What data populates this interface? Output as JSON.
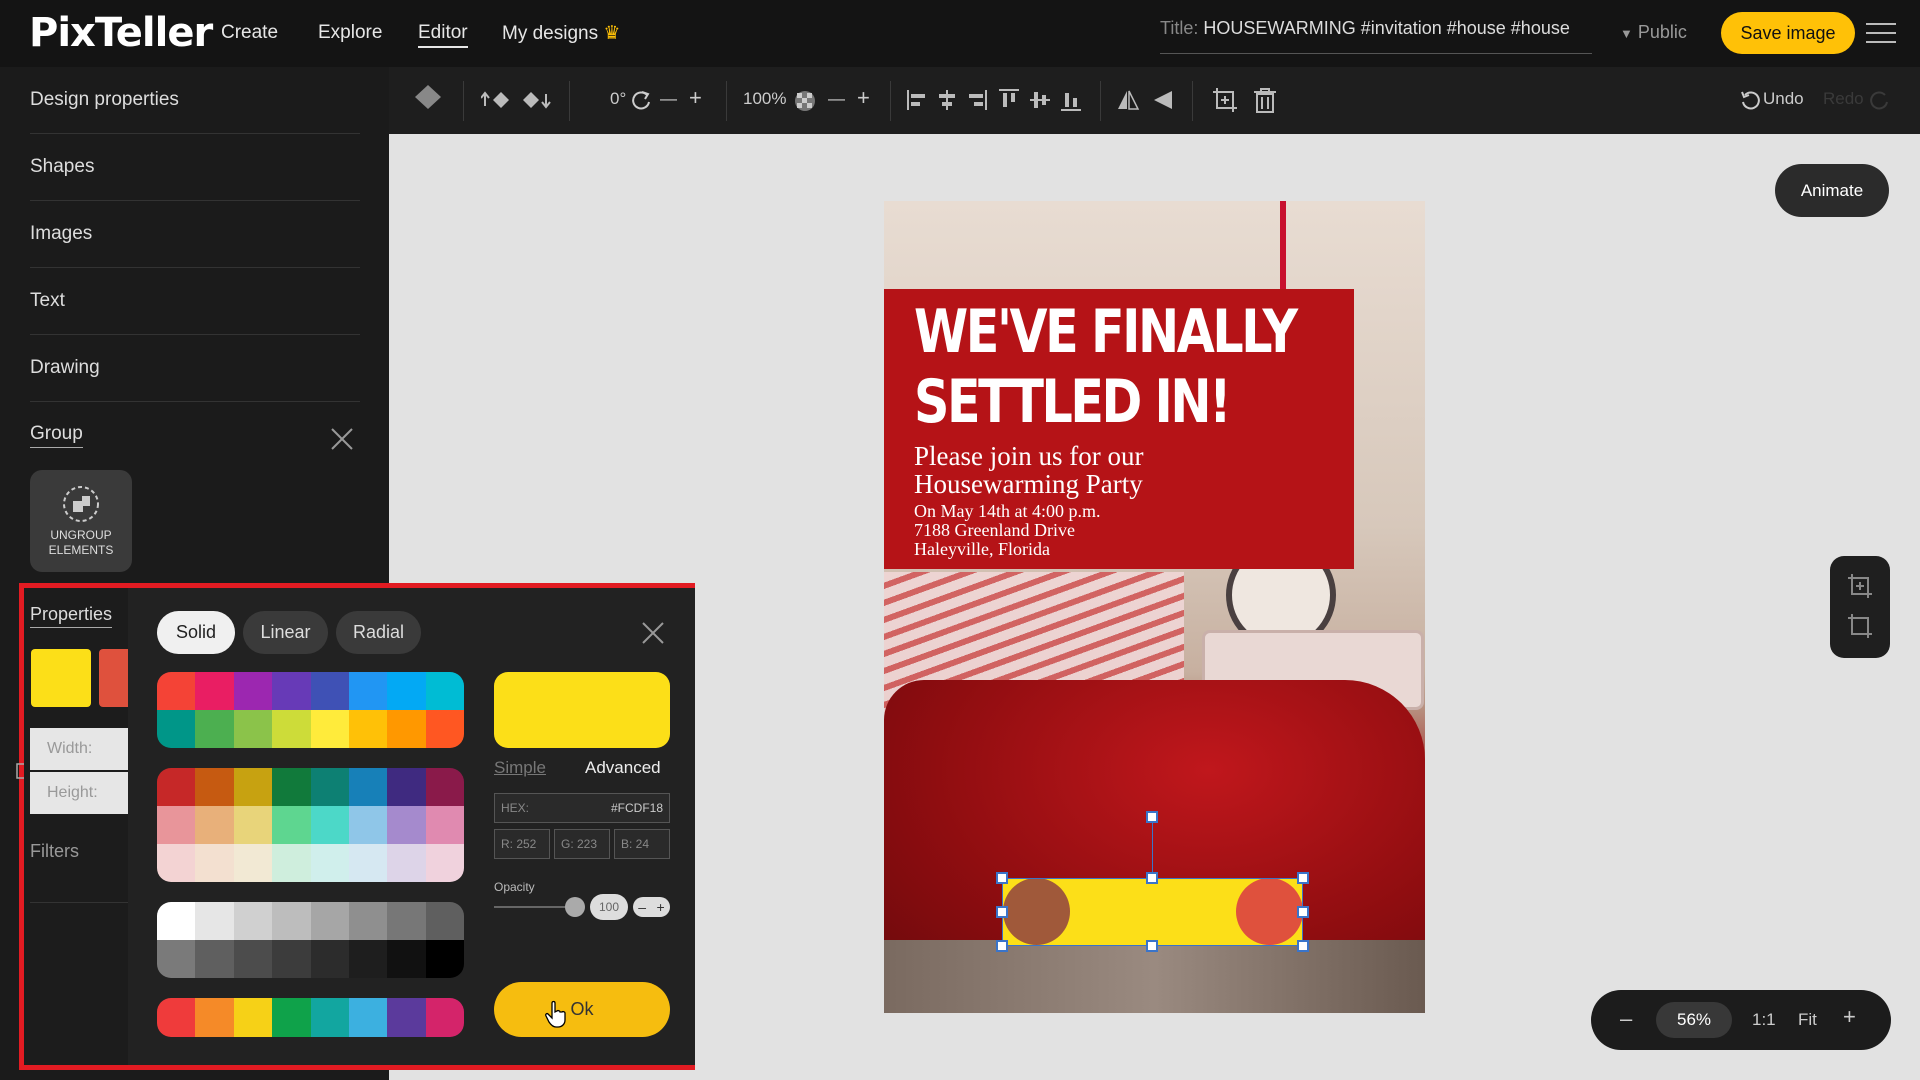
{
  "app": {
    "logo": "PixTeller",
    "nav": [
      "Create",
      "Explore",
      "Editor",
      "My designs"
    ],
    "title_label": "Title:",
    "title_value": "HOUSEWARMING #invitation #house #house",
    "visibility": "Public",
    "save_label": "Save image"
  },
  "sidebar": {
    "items": [
      "Design properties",
      "Shapes",
      "Images",
      "Text",
      "Drawing",
      "Group"
    ],
    "ungroup_line1": "UNGROUP",
    "ungroup_line2": "ELEMENTS"
  },
  "toolbar": {
    "rotation": "0°",
    "zoom_pct": "100%",
    "undo": "Undo",
    "redo": "Redo"
  },
  "design": {
    "headline_1": "WE'VE FINALLY",
    "headline_2": "SETTLED IN!",
    "subhead_1": "Please join us for our",
    "subhead_2": "Housewarming Party",
    "detail_1": "On May 14th at 4:00 p.m.",
    "detail_2": "7188 Greenland Drive",
    "detail_3": "Haleyville, Florida"
  },
  "canvas_controls": {
    "animate": "Animate",
    "zoom": "56%",
    "ratio": "1:1",
    "fit": "Fit"
  },
  "properties": {
    "label": "Properties",
    "width_label": "Width:",
    "height_label": "Height:",
    "filters_label": "Filters"
  },
  "picker": {
    "modes": [
      "Solid",
      "Linear",
      "Radial"
    ],
    "tab_simple": "Simple",
    "tab_advanced": "Advanced",
    "hex_label": "HEX:",
    "hex_value": "#FCDF18",
    "r": "R: 252",
    "g": "G: 223",
    "b": "B: 24",
    "opacity_label": "Opacity",
    "opacity_value": "100",
    "ok": "Ok",
    "current_color": "#FCDF18",
    "palette_1": [
      "#f44336",
      "#e91e63",
      "#9c27b0",
      "#673ab7",
      "#3f51b5",
      "#2196f3",
      "#03a9f4",
      "#00bcd4",
      "#009688",
      "#4caf50",
      "#8bc34a",
      "#cddc39",
      "#ffeb3b",
      "#ffc107",
      "#ff9800",
      "#ff5722"
    ],
    "palette_2": [
      "#c62828",
      "#c65a11",
      "#c7a211",
      "#117a3b",
      "#0d8073",
      "#1780b8",
      "#3f2a80",
      "#8a1a4a",
      "#e8959a",
      "#e8b07a",
      "#e8d47a",
      "#5ed690",
      "#4cd8c8",
      "#8fc6e8",
      "#a58acd",
      "#e08ab0",
      "#f3d3d3",
      "#f3e0d0",
      "#f2e9d4",
      "#cfeedd",
      "#d0efec",
      "#d6e8f2",
      "#ddd4e8",
      "#f0d2dd"
    ],
    "palette_3": [
      "#ffffff",
      "#e6e6e6",
      "#d0d0d0",
      "#bdbdbd",
      "#a6a6a6",
      "#8f8f8f",
      "#777777",
      "#5f5f5f",
      "#7a7a7a",
      "#5f5f5f",
      "#4c4c4c",
      "#3c3c3c",
      "#2c2c2c",
      "#1e1e1e",
      "#111111",
      "#000000"
    ],
    "palette_4": [
      "#ef3b3b",
      "#f58a28",
      "#f6d117",
      "#0fa24a",
      "#12a6a0",
      "#3cb0e0",
      "#5b3a9c",
      "#d4246a"
    ]
  }
}
